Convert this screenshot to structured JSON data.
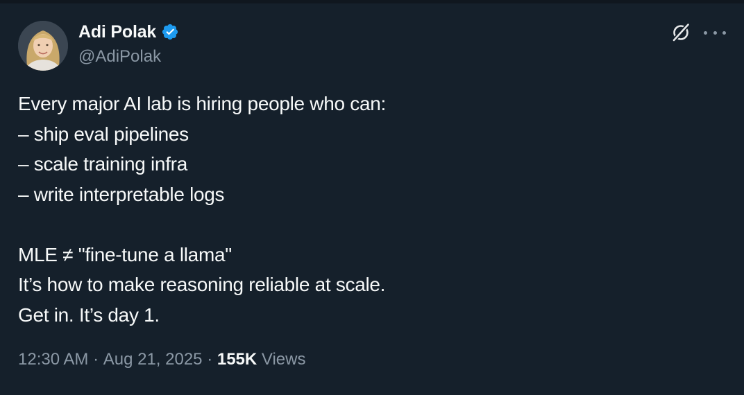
{
  "author": {
    "display_name": "Adi Polak",
    "handle": "@AdiPolak",
    "verified": true
  },
  "tweet": {
    "lines": [
      "Every major AI lab is hiring people who can:",
      "– ship eval pipelines",
      "– scale training infra",
      "– write interpretable logs",
      "",
      "MLE ≠ \"fine-tune a llama\"",
      "It’s how to make reasoning reliable at scale.",
      "Get in. It’s day 1."
    ]
  },
  "meta": {
    "time": "12:30 AM",
    "separator1": " · ",
    "date": "Aug 21, 2025",
    "separator2": " · ",
    "views_count": "155K",
    "views_label": " Views"
  },
  "icons": {
    "verified": "verified-badge-icon",
    "grok": "grok-icon",
    "more": "more-icon"
  },
  "colors": {
    "background": "#15202b",
    "text_primary": "#f7f9f9",
    "text_secondary": "#8b98a5",
    "verified_blue": "#1d9bf0"
  }
}
